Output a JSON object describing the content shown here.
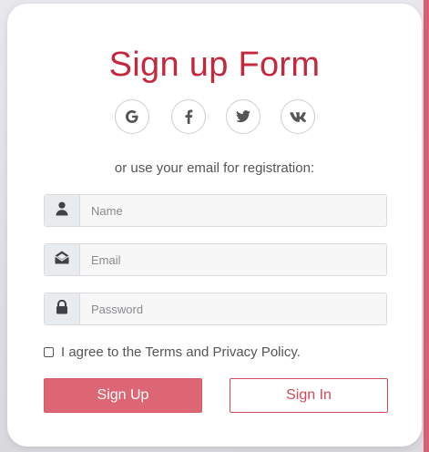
{
  "form": {
    "title": "Sign up Form",
    "subtitle": "or use your email for registration:",
    "social": [
      {
        "name": "google-icon",
        "glyph": "G"
      },
      {
        "name": "facebook-icon",
        "glyph": "f"
      },
      {
        "name": "twitter-icon",
        "glyph": "bird"
      },
      {
        "name": "vk-icon",
        "glyph": "vk"
      }
    ],
    "fields": {
      "name": {
        "placeholder": "Name",
        "value": "",
        "icon": "user-icon"
      },
      "email": {
        "placeholder": "Email",
        "value": "",
        "icon": "envelope-icon"
      },
      "password": {
        "placeholder": "Password",
        "value": "",
        "icon": "lock-icon"
      }
    },
    "terms_label": "I agree to the Terms and Privacy Policy.",
    "terms_checked": false,
    "signup_label": "Sign Up",
    "signin_label": "Sign In"
  },
  "colors": {
    "title": "#c4283e",
    "primary_button": "#dc6674",
    "outline_button": "#d4475a",
    "accent_strip": "#d9606f"
  }
}
